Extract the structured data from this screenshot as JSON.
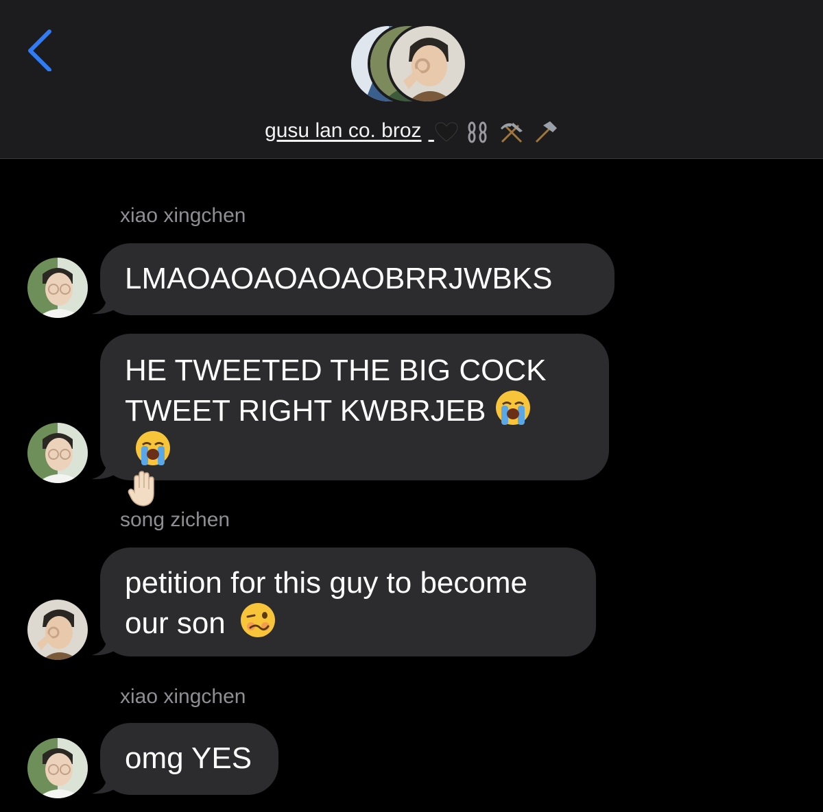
{
  "header": {
    "group_name": "gusu lan co. broz",
    "group_emojis": [
      "black-heart",
      "chains",
      "hammer-and-pick",
      "hammer"
    ]
  },
  "messages": [
    {
      "sender": "xiao xingchen",
      "text": "LMAOAOAOAOAOBRRJWBKS"
    },
    {
      "line1": "HE TWEETED THE BIG COCK",
      "line2": "TWEET RIGHT KWBRJEB",
      "emojis": [
        "loudly-crying-face",
        "loudly-crying-face",
        "raised-hand"
      ]
    },
    {
      "sender": "song zichen",
      "line1": "petition for this guy to become",
      "line2": "our son",
      "emojis": [
        "woozy-face"
      ]
    },
    {
      "sender": "xiao xingchen",
      "text": "omg YES"
    }
  ],
  "colors": {
    "background": "#000000",
    "header_bg": "#1c1c1e",
    "bubble_bg": "#2c2c2e",
    "accent_blue": "#2f7cf6",
    "sender_gray": "#8e8e93"
  }
}
